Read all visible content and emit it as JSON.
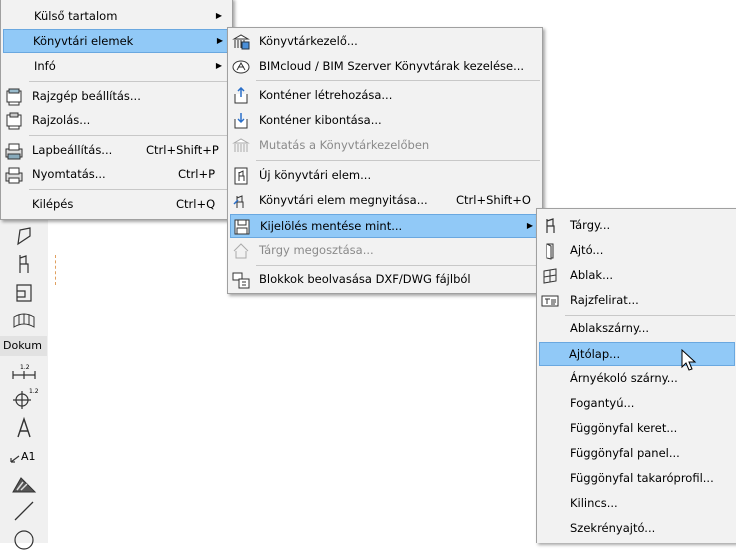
{
  "file_menu": {
    "items": [
      {
        "label": "Külső tartalom",
        "has_submenu": true
      },
      {
        "label": "Könyvtári elemek",
        "has_submenu": true,
        "highlighted": true
      },
      {
        "label": "Infó",
        "has_submenu": true
      },
      {
        "label": "Rajzgép beállítás...",
        "icon": "plotter-setup-icon"
      },
      {
        "label": "Rajzolás...",
        "icon": "plot-icon"
      },
      {
        "label": "Lapbeállítás...",
        "shortcut": "Ctrl+Shift+P",
        "icon": "page-setup-icon"
      },
      {
        "label": "Nyomtatás...",
        "shortcut": "Ctrl+P",
        "icon": "printer-icon"
      },
      {
        "label": "Kilépés",
        "shortcut": "Ctrl+Q"
      }
    ]
  },
  "library_menu": {
    "items": [
      {
        "label": "Könyvtárkezelő...",
        "icon": "library-manager-icon"
      },
      {
        "label": "BIMcloud / BIM Szerver Könyvtárak kezelése...",
        "icon": "bimcloud-icon"
      },
      {
        "label": "Konténer létrehozása...",
        "icon": "create-container-icon"
      },
      {
        "label": "Konténer kibontása...",
        "icon": "extract-container-icon"
      },
      {
        "label": "Mutatás a Könyvtárkezelőben",
        "icon": "show-in-library-icon",
        "disabled": true
      },
      {
        "label": "Új könyvtári elem...",
        "icon": "new-library-part-icon"
      },
      {
        "label": "Könyvtári elem megnyitása...",
        "shortcut": "Ctrl+Shift+O",
        "icon": "open-library-part-icon"
      },
      {
        "label": "Kijelölés mentése mint...",
        "icon": "save-selection-icon",
        "has_submenu": true,
        "highlighted": true
      },
      {
        "label": "Tárgy megosztása...",
        "icon": "share-object-icon",
        "disabled": true
      },
      {
        "label": "Blokkok beolvasása DXF/DWG fájlból",
        "icon": "dxf-import-icon"
      }
    ]
  },
  "save_as_menu": {
    "items": [
      {
        "label": "Tárgy...",
        "icon": "object-icon"
      },
      {
        "label": "Ajtó...",
        "icon": "door-icon"
      },
      {
        "label": "Ablak...",
        "icon": "window-icon"
      },
      {
        "label": "Rajzfelirat...",
        "icon": "label-icon"
      },
      {
        "label": "Ablakszárny..."
      },
      {
        "label": "Ajtólap...",
        "highlighted": true
      },
      {
        "label": "Árnyékoló szárny..."
      },
      {
        "label": "Fogantyú..."
      },
      {
        "label": "Függönyfal keret..."
      },
      {
        "label": "Függönyfal panel..."
      },
      {
        "label": "Függönyfal takaróprofil..."
      },
      {
        "label": "Kilincs..."
      },
      {
        "label": "Szekrényajtó..."
      }
    ]
  },
  "toolbox": {
    "section_label": "Dokum",
    "icons": [
      "roof-tool-icon",
      "object-tool-icon",
      "zone-tool-icon",
      "mesh-tool-icon",
      "dimension-tool-icon",
      "level-dimension-tool-icon",
      "text-tool-icon",
      "label-tool-icon",
      "fill-tool-icon",
      "line-tool-icon",
      "circle-tool-icon"
    ]
  },
  "colors": {
    "menu_bg": "#f2f2f2",
    "highlight_bg": "#91c9f7",
    "highlight_border": "#6aa8e0",
    "disabled_text": "#8a8a8a"
  }
}
